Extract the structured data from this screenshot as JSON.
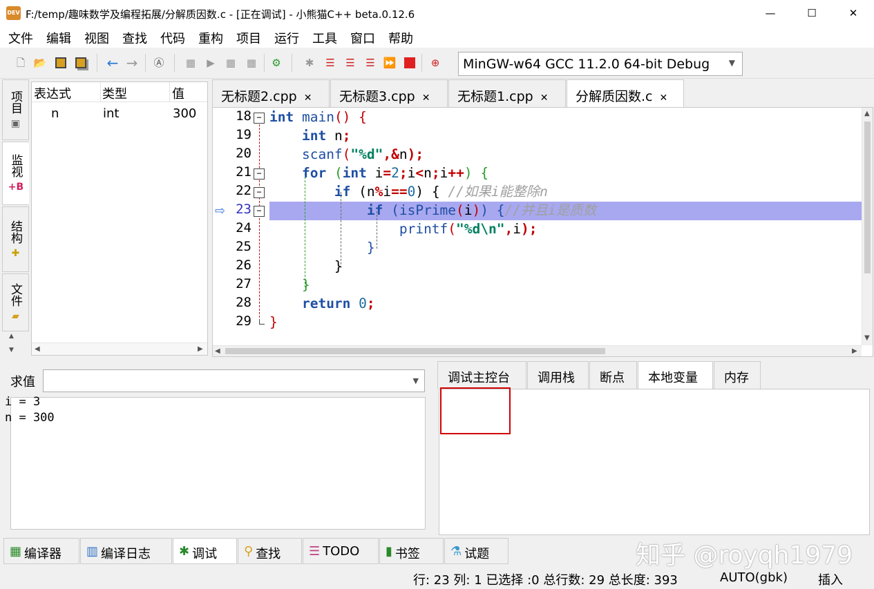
{
  "window": {
    "title": "F:/temp/趣味数学及编程拓展/分解质因数.c - [正在调试] - 小熊猫C++ beta.0.12.6",
    "icon_text": "DEV",
    "minimize": "—",
    "maximize": "☐",
    "close": "✕"
  },
  "menu": [
    "文件",
    "编辑",
    "视图",
    "查找",
    "代码",
    "重构",
    "项目",
    "运行",
    "工具",
    "窗口",
    "帮助"
  ],
  "toolbar": {
    "compiler": "MinGW-w64 GCC 11.2.0 64-bit Debug",
    "icons": [
      "new-file-icon",
      "open-file-icon",
      "save-icon",
      "save-all-icon",
      "back-icon",
      "forward-icon",
      "format-icon",
      "compile-icon",
      "run-icon",
      "compile-run-icon",
      "rebuild-icon",
      "debug-icon",
      "step-over-icon",
      "step-into-icon",
      "step-out-icon",
      "continue-icon",
      "stop-icon",
      "add-watch-icon"
    ]
  },
  "left_tabs": [
    {
      "label": "项目",
      "icon": "project-icon"
    },
    {
      "label": "监视",
      "icon": "watch-icon"
    },
    {
      "label": "结构",
      "icon": "structure-icon"
    },
    {
      "label": "文件",
      "icon": "folder-icon"
    }
  ],
  "watch": {
    "columns": [
      "表达式",
      "类型",
      "值"
    ],
    "rows": [
      {
        "expr": "n",
        "type": "int",
        "value": "300"
      }
    ]
  },
  "editor_tabs": [
    {
      "label": "无标题2.cpp",
      "close": "✕"
    },
    {
      "label": "无标题3.cpp",
      "close": "✕"
    },
    {
      "label": "无标题1.cpp",
      "close": "✕"
    },
    {
      "label": "分解质因数.c",
      "close": "✕"
    }
  ],
  "editor": {
    "line_numbers": [
      "18",
      "19",
      "20",
      "21",
      "22",
      "23",
      "24",
      "25",
      "26",
      "27",
      "28",
      "29"
    ],
    "current_line": "23",
    "fold_markers": [
      "−",
      "−",
      "−",
      "−"
    ],
    "code": {
      "l18": [
        "int",
        " main",
        "()",
        " {"
      ],
      "l19": [
        "int",
        " n",
        ";"
      ],
      "l20": [
        "scanf",
        "(",
        "\"%d\"",
        ",&",
        "n",
        ");"
      ],
      "l21": [
        "for",
        " (",
        "int",
        " i",
        "=",
        "2",
        ";",
        "i",
        "<",
        "n",
        ";",
        "i",
        "++",
        ") {"
      ],
      "l22": [
        "if",
        " (n",
        "%",
        "i",
        "==",
        "0",
        ") {",
        " //如果i能整除n"
      ],
      "l23": [
        "if",
        " (",
        "isPrime",
        "(",
        "i",
        ")",
        ") {",
        "//并且i是质数"
      ],
      "l24": [
        "printf",
        "(",
        "\"%d\\n\"",
        ",",
        "i",
        ");"
      ],
      "l25": [
        "}"
      ],
      "l26": [
        "}"
      ],
      "l27": [
        "}"
      ],
      "l28": [
        "return",
        " 0",
        ";"
      ],
      "l29": [
        "}"
      ]
    }
  },
  "eval": {
    "label": "求值",
    "value": ""
  },
  "debug_tabs": [
    "调试主控台",
    "调用栈",
    "断点",
    "本地变量",
    "内存"
  ],
  "locals": [
    "i = 3",
    "n = 300"
  ],
  "bottom_tabs": [
    {
      "label": "编译器",
      "icon": "compiler-grid-icon"
    },
    {
      "label": "编译日志",
      "icon": "bar-chart-icon"
    },
    {
      "label": "调试",
      "icon": "bug-icon"
    },
    {
      "label": "查找",
      "icon": "search-icon"
    },
    {
      "label": "TODO",
      "icon": "todo-list-icon"
    },
    {
      "label": "书签",
      "icon": "bookmark-icon"
    },
    {
      "label": "试题",
      "icon": "flask-icon"
    }
  ],
  "status": {
    "position": "行: 23 列: 1 已选择 :0 总行数: 29 总长度: 393",
    "encoding": "AUTO(gbk)",
    "mode": "插入"
  },
  "watermark": "知乎 @royqh1979",
  "colors": {
    "highlight": "#a8a8f0",
    "keyword": "#1f4fa3",
    "string": "#008060",
    "comment": "#a0a0a0",
    "redbox": "#d00000"
  }
}
